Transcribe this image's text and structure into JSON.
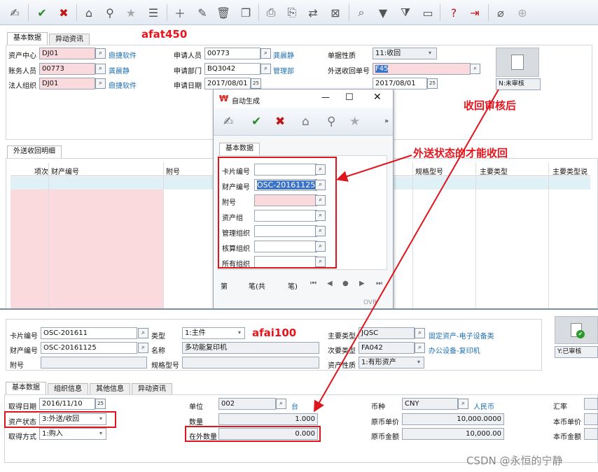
{
  "toolbar": {
    "icons": [
      "sign-icon",
      "check-icon",
      "cancel-icon",
      "home-icon",
      "pin-icon",
      "star-icon",
      "list-icon",
      "add-icon",
      "edit-icon",
      "delete-icon",
      "copy-icon",
      "print-icon",
      "print-preview-icon",
      "query-icon",
      "export-icon",
      "search-icon",
      "filter-icon",
      "filter-list-icon",
      "window-icon",
      "help-icon",
      "exit-icon",
      "attach-icon",
      "target-icon"
    ]
  },
  "afat450": {
    "tabs": [
      "基本数据",
      "异动资讯"
    ],
    "fields": {
      "asset_center_label": "资产中心",
      "asset_center": "DJ01",
      "asset_center_name": "鼎捷软件",
      "account_person_label": "账务人员",
      "account_person": "00773",
      "account_person_name": "龚晨静",
      "legal_org_label": "法人组织",
      "legal_org": "DJ01",
      "legal_org_name": "鼎捷软件",
      "applicant_label": "申请人员",
      "applicant": "00773",
      "applicant_name": "龚晨静",
      "dept_label": "申请部门",
      "dept": "BQ3042",
      "dept_name": "管理部",
      "apply_date_label": "申请日期",
      "apply_date": "2017/08/01",
      "doc_type_label": "单据性质",
      "doc_type": "11:收回",
      "return_no_label": "外送收回单号",
      "return_no": "F45",
      "date2": "2017/08/01",
      "status": "N:未审核"
    },
    "detail_tab": "外送收回明细",
    "detail_columns": [
      "项次",
      "财产编号",
      "附号",
      "规格型号",
      "主要类型",
      "主要类型说"
    ]
  },
  "dialog": {
    "title": "自动生成",
    "tab": "基本数据",
    "fields": [
      {
        "label": "卡片编号",
        "value": ""
      },
      {
        "label": "财产编号",
        "value": "OSC-20161125"
      },
      {
        "label": "附号",
        "value": ""
      },
      {
        "label": "资产组",
        "value": ""
      },
      {
        "label": "管理组织",
        "value": ""
      },
      {
        "label": "核算组织",
        "value": ""
      },
      {
        "label": "所有组织",
        "value": ""
      }
    ],
    "pager": {
      "a": "第",
      "b": "笔(共",
      "c": "笔)"
    },
    "ovr": "OVR"
  },
  "afai100": {
    "fields": {
      "card_no_label": "卡片编号",
      "card_no": "OSC-201611",
      "asset_no_label": "财产编号",
      "asset_no": "OSC-20161125",
      "sub_no_label": "附号",
      "type_label": "类型",
      "type": "1:主件",
      "name_label": "名称",
      "name": "多功能复印机",
      "spec_label": "规格型号",
      "main_type_label": "主要类型",
      "main_type": "JQSC",
      "main_type_name": "固定资产-电子设备类",
      "sub_type_label": "次要类型",
      "sub_type": "FA042",
      "sub_type_name": "办公设备-复印机",
      "nature_label": "资产性质",
      "nature": "1:有形资产",
      "status": "Y:已审核"
    },
    "tabs": [
      "基本数据",
      "组织信息",
      "其他信息",
      "异动资讯"
    ],
    "basic": {
      "acq_date_label": "取得日期",
      "acq_date": "2016/11/10",
      "asset_status_label": "资产状态",
      "asset_status": "3:外送/收回",
      "acq_method_label": "取得方式",
      "acq_method": "1:购入",
      "unit_label": "单位",
      "unit": "002",
      "unit_name": "台",
      "qty_label": "数量",
      "qty": "1.000",
      "out_qty_label": "在外数量",
      "out_qty": "0.000",
      "currency_label": "币种",
      "currency": "CNY",
      "currency_name": "人民币",
      "orig_price_label": "原币单价",
      "orig_price": "10,000.0000",
      "orig_amount_label": "原币金额",
      "orig_amount": "10,000.00",
      "rate_label": "汇率",
      "local_price_label": "本币单价",
      "local_amount_label": "本币金额"
    }
  },
  "annotations": {
    "t1": "afat450",
    "t2": "收回审核后",
    "t3": "外送状态的才能收回",
    "t4": "afai100"
  },
  "watermark": "CSDN @永恒的宁静"
}
